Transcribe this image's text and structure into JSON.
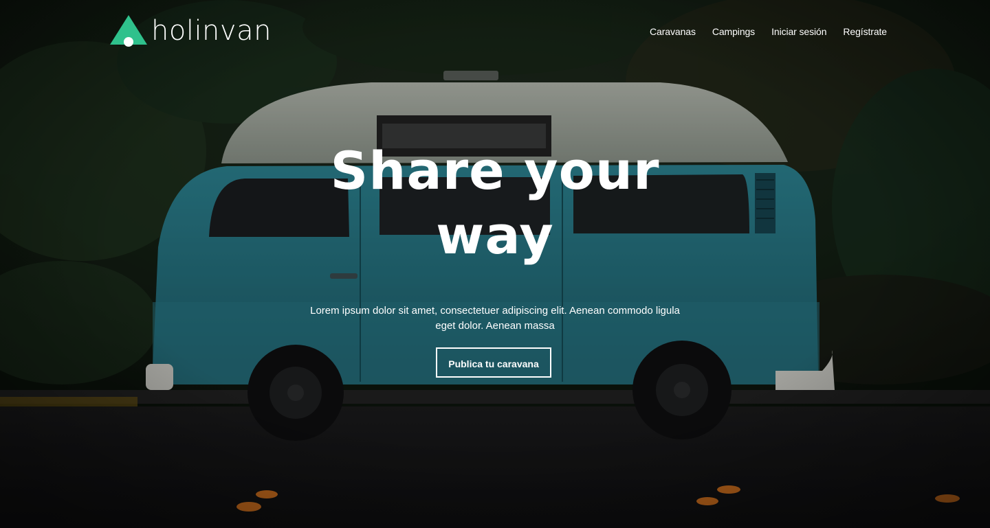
{
  "brand": {
    "name": "holinvan",
    "accent_color": "#2fc18c"
  },
  "nav": {
    "items": [
      {
        "label": "Caravanas"
      },
      {
        "label": "Campings"
      },
      {
        "label": "Iniciar sesión"
      },
      {
        "label": "Regístrate"
      }
    ]
  },
  "hero": {
    "title": "Share your way",
    "subtitle": "Lorem ipsum dolor sit amet, consectetuer adipiscing elit. Aenean commodo ligula eget dolor. Aenean massa",
    "cta_label": "Publica tu caravana",
    "background": "vintage-camper-van-photo"
  }
}
